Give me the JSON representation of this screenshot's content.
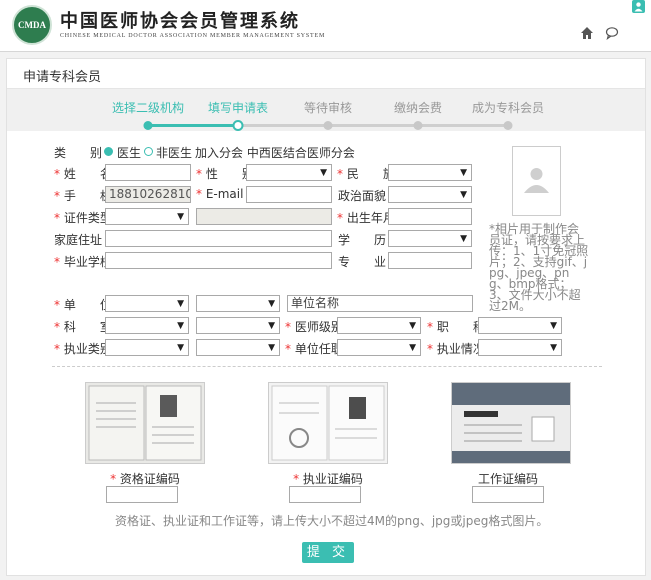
{
  "header": {
    "logo_text": "CMDA",
    "title": "中国医师协会会员管理系统",
    "subtitle": "CHINESE MEDICAL DOCTOR ASSOCIATION MEMBER MANAGEMENT SYSTEM"
  },
  "panel": {
    "title": "申请专科会员"
  },
  "steps": [
    {
      "label": "选择二级机构",
      "state": "done"
    },
    {
      "label": "填写申请表",
      "state": "current"
    },
    {
      "label": "等待审核",
      "state": "todo"
    },
    {
      "label": "缴纳会费",
      "state": "todo"
    },
    {
      "label": "成为专科会员",
      "state": "todo"
    }
  ],
  "form": {
    "category_label": "类　　别",
    "radio_doctor": "医生",
    "radio_nondoctor": "非医生",
    "branch_text": "加入分会 中西医结合医师分会",
    "name_label": "姓　　名",
    "gender_label": "性　　别",
    "ethnicity_label": "民　　族",
    "phone_label": "手　　机",
    "phone_value": "18810262810",
    "email_label": "E-mail",
    "political_label": "政治面貌",
    "idtype_label": "证件类型",
    "birth_label": "出生年月",
    "address_label": "家庭住址",
    "education_label": "学　　历",
    "school_label": "毕业学校",
    "major_label": "专　　业",
    "unit_label": "单　　位",
    "unit_placeholder": "单位名称",
    "dept_label": "科　　室",
    "doctor_level_label": "医师级别",
    "title_label": "职　　称",
    "practice_type_label": "执业类别",
    "unit_position_label": "单位任职",
    "practice_status_label": "执业情况",
    "photo_note": "*相片用于制作会员证，请按要求上传：1、1寸免冠照片；2、支持gif、jpg、jpeg、png、bmp格式；3、文件大小不超过2M。"
  },
  "certificates": [
    {
      "label": "资格证编码",
      "required": true
    },
    {
      "label": "执业证编码",
      "required": true
    },
    {
      "label": "工作证编码",
      "required": false
    }
  ],
  "hint": "资格证、执业证和工作证等，请上传大小不超过4M的png、jpg或jpeg格式图片。",
  "submit_label": "提 交",
  "colors": {
    "accent": "#3bbeb2",
    "required": "#e33333",
    "logo": "#2e7d4f"
  }
}
